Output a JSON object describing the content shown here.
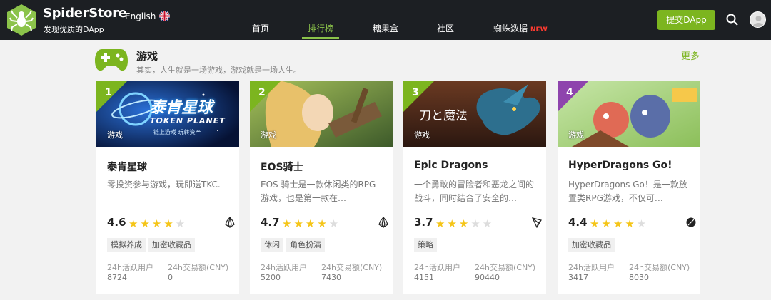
{
  "header": {
    "brand_name": "SpiderStore",
    "brand_slogan": "发现优质的DApp",
    "language": "English",
    "nav": [
      {
        "label": "首页",
        "active": false
      },
      {
        "label": "排行榜",
        "active": true
      },
      {
        "label": "糖果盒",
        "active": false
      },
      {
        "label": "社区",
        "active": false
      },
      {
        "label": "蜘蛛数据",
        "active": false,
        "badge": "NEW"
      }
    ],
    "submit_label": "提交DApp",
    "accent": "#7cb51f"
  },
  "section": {
    "title": "游戏",
    "subtitle": "其实，人生就是一场游戏，游戏就是一场人生。",
    "more_label": "更多"
  },
  "cards": [
    {
      "rank": "1",
      "banner_tag": "游戏",
      "banner_text": "泰肯星球",
      "banner_sub": "TOKEN PLANET",
      "banner_tagline": "链上游戏 玩转资产",
      "title": "泰肯星球",
      "desc": "零投资参与游戏，玩即送TKC.",
      "rating": "4.6",
      "stars": 4,
      "chain_icon": "eos-icon",
      "tags": [
        "模拟养成",
        "加密收藏品"
      ],
      "stat1_label": "24h活跃用户",
      "stat1_value": "8724",
      "stat2_label": "24h交易额(CNY)",
      "stat2_value": "0"
    },
    {
      "rank": "2",
      "banner_tag": "游戏",
      "title": "EOS骑士",
      "desc": "EOS 骑士是一款休闲类的RPG游戏，也是第一款在…",
      "rating": "4.7",
      "stars": 4,
      "chain_icon": "eos-icon",
      "tags": [
        "休闲",
        "角色扮演"
      ],
      "stat1_label": "24h活跃用户",
      "stat1_value": "5200",
      "stat2_label": "24h交易额(CNY)",
      "stat2_value": "7430"
    },
    {
      "rank": "3",
      "banner_tag": "游戏",
      "banner_text": "刀と魔法",
      "title": "Epic Dragons",
      "desc": "一个勇敢的冒险者和恶龙之间的战斗，同时结合了安全的…",
      "rating": "3.7",
      "stars": 3,
      "chain_icon": "tron-icon",
      "tags": [
        "策略"
      ],
      "stat1_label": "24h活跃用户",
      "stat1_value": "4151",
      "stat2_label": "24h交易额(CNY)",
      "stat2_value": "90440"
    },
    {
      "rank": "4",
      "banner_tag": "游戏",
      "title": "HyperDragons Go!",
      "desc": "HyperDragons Go！是一款放置类RPG游戏，不仅可…",
      "rating": "4.4",
      "stars": 4,
      "chain_icon": "ontology-icon",
      "tags": [
        "加密收藏品"
      ],
      "stat1_label": "24h活跃用户",
      "stat1_value": "3417",
      "stat2_label": "24h交易额(CNY)",
      "stat2_value": "8030"
    }
  ]
}
